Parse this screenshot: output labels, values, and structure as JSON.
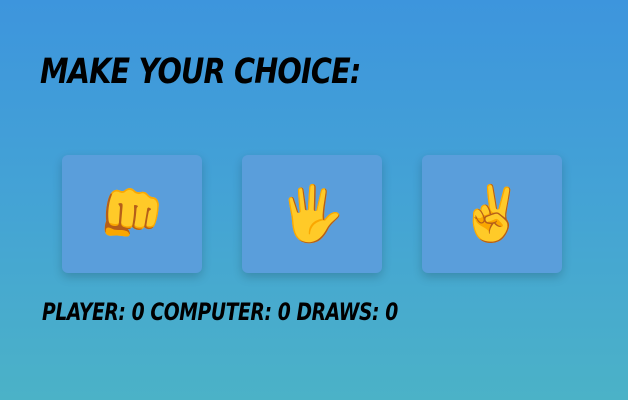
{
  "heading": "Make your choice:",
  "choices": [
    {
      "name": "rock",
      "icon": "👊"
    },
    {
      "name": "paper",
      "icon": "🖐️"
    },
    {
      "name": "scissors",
      "icon": "✌️"
    }
  ],
  "score": {
    "player_label": "Player:",
    "player_value": "0",
    "computer_label": "Computer:",
    "computer_value": "0",
    "draws_label": "Draws:",
    "draws_value": "0"
  }
}
